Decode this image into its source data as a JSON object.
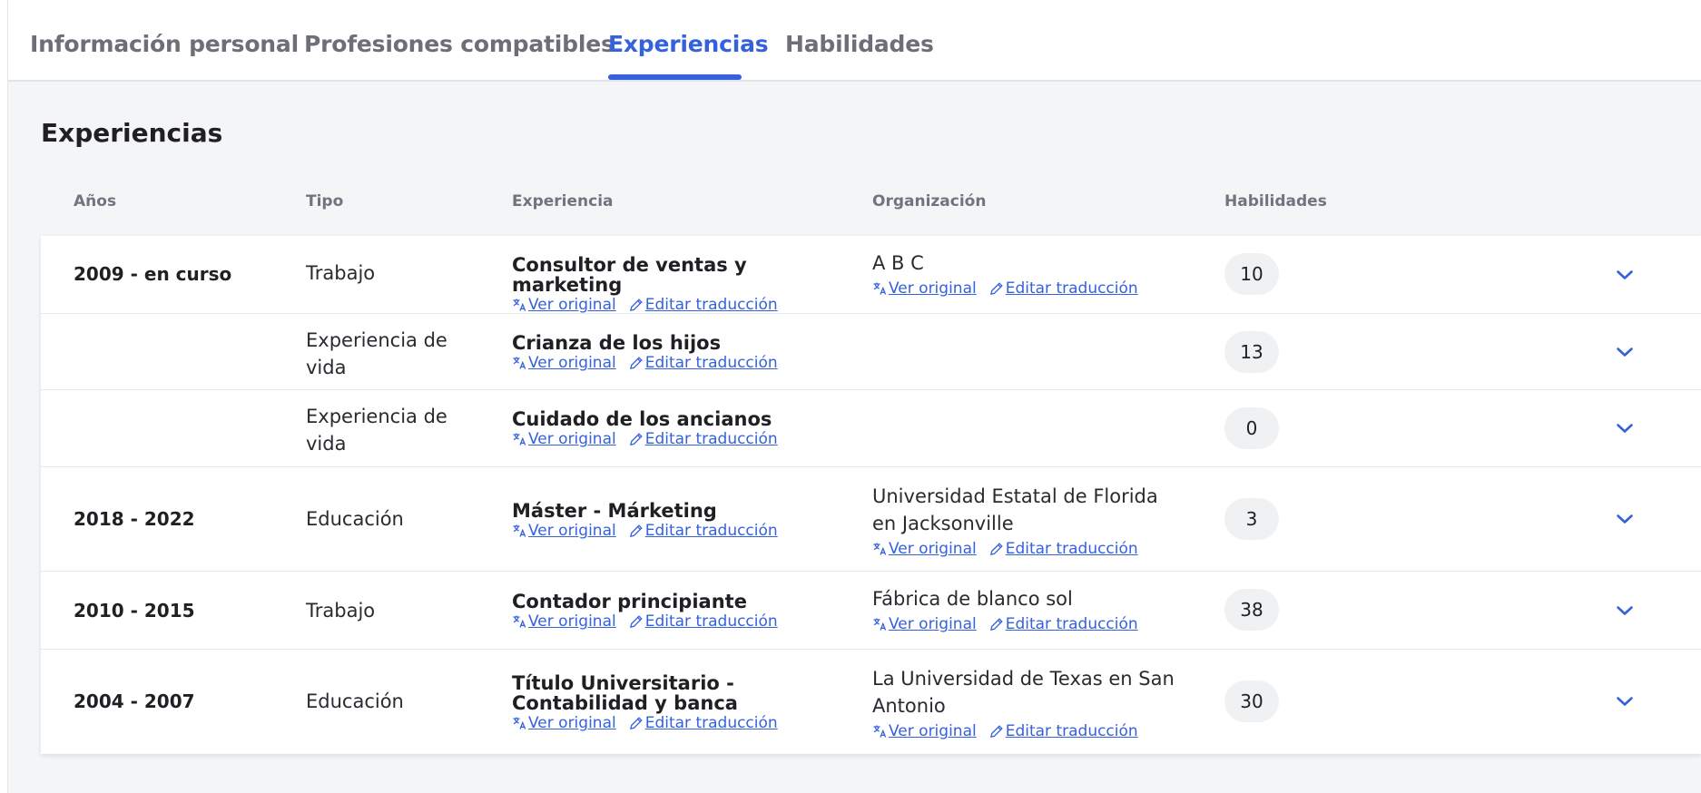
{
  "tabs": [
    {
      "label": "Información personal"
    },
    {
      "label": "Profesiones compatibles"
    },
    {
      "label": "Experiencias",
      "active": true
    },
    {
      "label": "Habilidades"
    }
  ],
  "section": {
    "title": "Experiencias"
  },
  "columns": {
    "years": "Años",
    "type": "Tipo",
    "experience": "Experiencia",
    "organization": "Organización",
    "skills": "Habilidades"
  },
  "links": {
    "view_original": "Ver original",
    "edit_translation": "Editar traducción"
  },
  "rows": [
    {
      "years": "2009 - en curso",
      "type": "Trabajo",
      "experience": "Consultor de ventas y marketing",
      "organization": "A B C",
      "skills": "10"
    },
    {
      "years": "",
      "type": "Experiencia de vida",
      "experience": "Crianza de los hijos",
      "organization": "",
      "skills": "13"
    },
    {
      "years": "",
      "type": "Experiencia de vida",
      "experience": "Cuidado de los ancianos",
      "organization": "",
      "skills": "0"
    },
    {
      "years": "2018 - 2022",
      "type": "Educación",
      "experience": "Máster - Márketing",
      "organization": "Universidad Estatal de Florida en Jacksonville",
      "skills": "3"
    },
    {
      "years": "2010 - 2015",
      "type": "Trabajo",
      "experience": "Contador principiante",
      "organization": "Fábrica de blanco sol",
      "skills": "38"
    },
    {
      "years": "2004 - 2007",
      "type": "Educación",
      "experience": "Título Universitario - Contabilidad y banca",
      "organization": "La Universidad de Texas en San Antonio",
      "skills": "30"
    }
  ],
  "colors": {
    "accent": "#3562dc",
    "background": "#f4f5f7",
    "badge": "#f0f1f3"
  },
  "icons": {
    "translate": "translate-icon",
    "edit": "pencil-icon",
    "expand": "chevron-down-icon"
  }
}
